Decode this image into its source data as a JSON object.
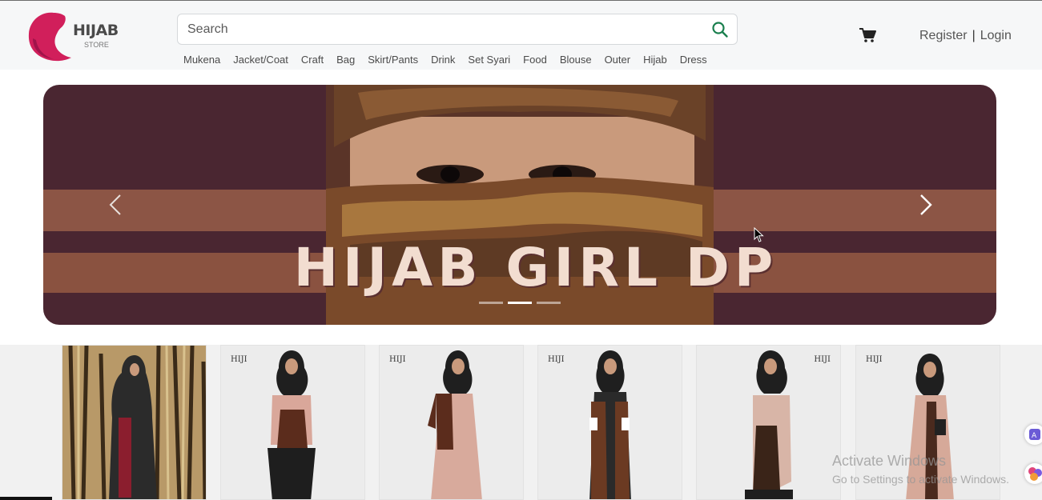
{
  "brand": {
    "name": "HIJAB",
    "sub": "STORE"
  },
  "search": {
    "placeholder": "Search"
  },
  "categories": [
    "Mukena",
    "Jacket/Coat",
    "Craft",
    "Bag",
    "Skirt/Pants",
    "Drink",
    "Set Syari",
    "Food",
    "Blouse",
    "Outer",
    "Hijab",
    "Dress"
  ],
  "auth": {
    "register": "Register",
    "separator": "|",
    "login": "Login"
  },
  "carousel": {
    "title": "HIJAB GIRL DP",
    "slides": 3,
    "active_slide": 2
  },
  "products": [
    {
      "brand": "",
      "colors": [
        "#2b2b2b",
        "#8b1e2e"
      ]
    },
    {
      "brand": "HIJI",
      "colors": [
        "#d9a79a",
        "#2a2a2a"
      ]
    },
    {
      "brand": "HIJI",
      "colors": [
        "#d8aa9c",
        "#5b2c1c"
      ]
    },
    {
      "brand": "HIJI",
      "colors": [
        "#2a2a2a",
        "#6b3a22"
      ]
    },
    {
      "brand": "HIJI",
      "colors": [
        "#d8b5a7",
        "#3a2418"
      ]
    },
    {
      "brand": "HIJI",
      "colors": [
        "#d6a999",
        "#4a2a1e"
      ]
    }
  ],
  "watermark": {
    "line1": "Activate Windows",
    "line2": "Go to Settings to activate Windows."
  },
  "colors": {
    "accent": "#1a7f4e",
    "brand_pink": "#d11f5b",
    "banner_bg": "#4a2631"
  }
}
